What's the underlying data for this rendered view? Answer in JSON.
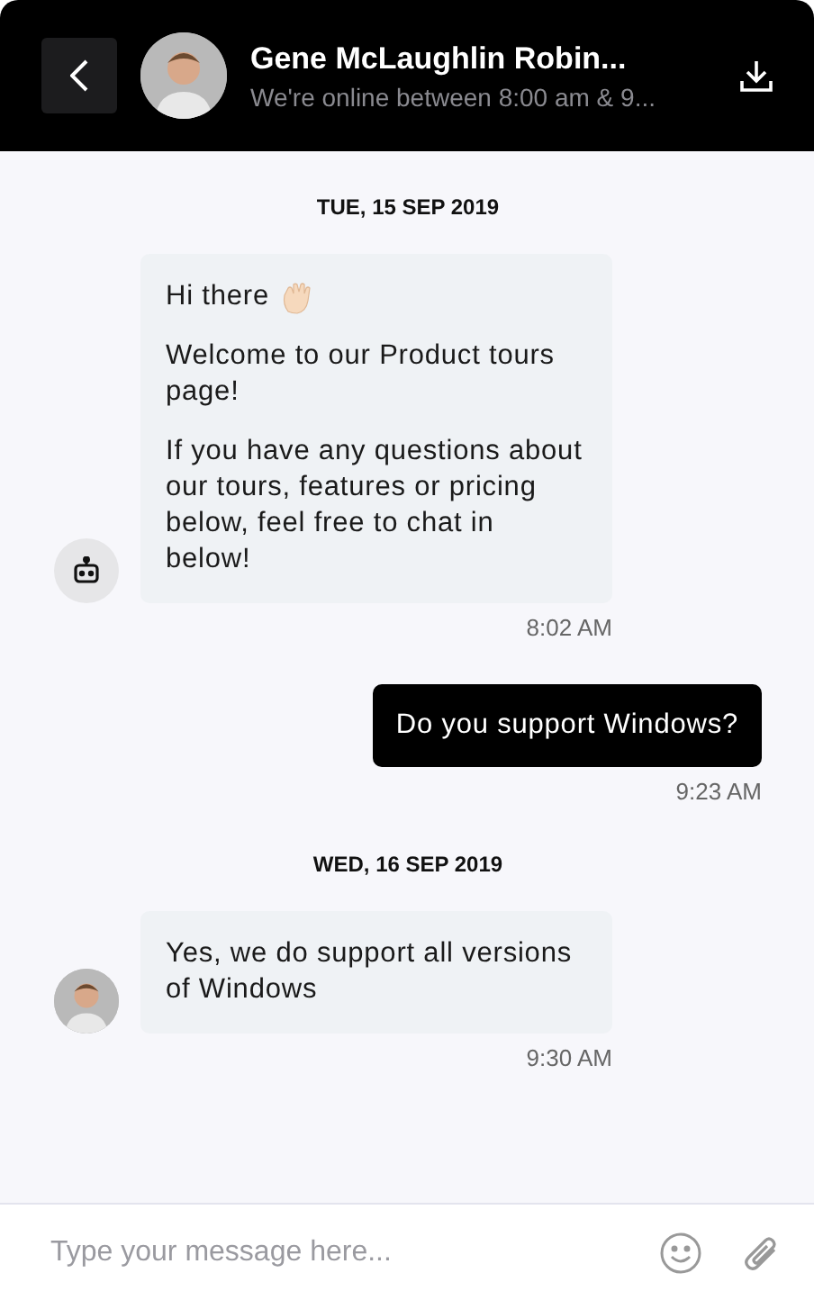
{
  "header": {
    "name": "Gene McLaughlin Robin...",
    "subtitle": "We're online between 8:00 am & 9..."
  },
  "conversation": [
    {
      "kind": "date",
      "label": "TUE, 15 SEP 2019"
    },
    {
      "kind": "bot",
      "paragraphs": [
        "Hi there",
        "Welcome to our Product tours page!",
        "If you have any questions about our tours, features or pricing below, feel free to chat in below!"
      ],
      "wave": true,
      "time": "8:02 AM"
    },
    {
      "kind": "user",
      "paragraphs": [
        "Do you support Windows?"
      ],
      "time": "9:23 AM"
    },
    {
      "kind": "date",
      "label": "WED, 16 SEP 2019"
    },
    {
      "kind": "agent",
      "paragraphs": [
        "Yes, we do support all versions of Windows"
      ],
      "time": "9:30 AM"
    }
  ],
  "composer": {
    "placeholder": "Type your message here..."
  }
}
